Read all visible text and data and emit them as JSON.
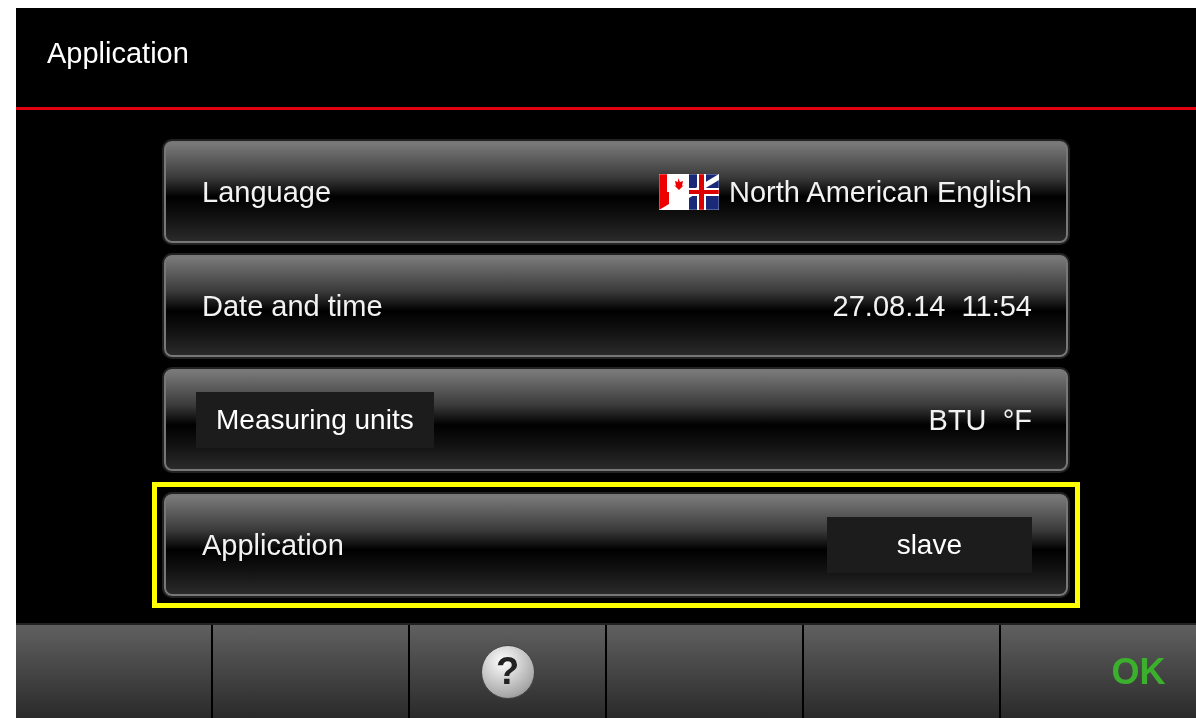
{
  "header": {
    "title": "Application"
  },
  "rows": [
    {
      "label": "Language",
      "label_annotated": false,
      "value": "North American English",
      "value_annotated": false,
      "flag": true,
      "selected": false
    },
    {
      "label": "Date and time",
      "label_annotated": false,
      "value": "27.08.14  11:54",
      "value_annotated": false,
      "flag": false,
      "selected": false
    },
    {
      "label": "Measuring units",
      "label_annotated": true,
      "value": "BTU  °F",
      "value_annotated": false,
      "flag": false,
      "selected": false
    },
    {
      "label": "Application",
      "label_annotated": false,
      "value": "slave",
      "value_annotated": true,
      "flag": false,
      "selected": true
    }
  ],
  "bottom_bar": [
    {
      "kind": "empty"
    },
    {
      "kind": "empty"
    },
    {
      "kind": "help",
      "label": "?"
    },
    {
      "kind": "empty"
    },
    {
      "kind": "empty"
    },
    {
      "kind": "ok",
      "label": "OK"
    }
  ]
}
